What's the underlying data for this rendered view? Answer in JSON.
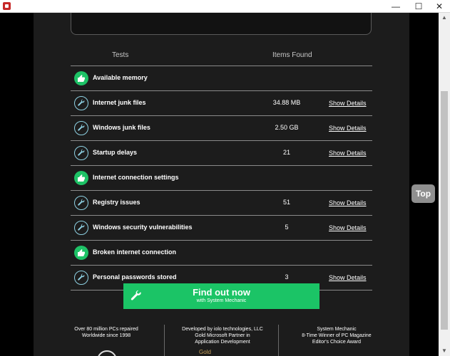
{
  "window": {
    "buttons": {
      "minimize": "—",
      "maximize": "☐",
      "close": "✕"
    }
  },
  "page": {
    "top_button": "Top",
    "table": {
      "headers": {
        "tests": "Tests",
        "items": "Items Found"
      },
      "rows": [
        {
          "icon": "thumbs-up-icon",
          "label": "Available memory",
          "value": "",
          "link": ""
        },
        {
          "icon": "wrench-icon",
          "label": "Internet junk files",
          "value": "34.88 MB",
          "link": "Show Details"
        },
        {
          "icon": "wrench-icon",
          "label": "Windows junk files",
          "value": "2.50 GB",
          "link": "Show Details"
        },
        {
          "icon": "wrench-icon",
          "label": "Startup delays",
          "value": "21",
          "link": "Show Details"
        },
        {
          "icon": "thumbs-up-icon",
          "label": "Internet connection settings",
          "value": "",
          "link": ""
        },
        {
          "icon": "wrench-icon",
          "label": "Registry issues",
          "value": "51",
          "link": "Show Details"
        },
        {
          "icon": "wrench-icon",
          "label": "Windows security vulnerabilities",
          "value": "5",
          "link": "Show Details"
        },
        {
          "icon": "thumbs-up-icon",
          "label": "Broken internet connection",
          "value": "",
          "link": ""
        },
        {
          "icon": "wrench-icon",
          "label": "Personal passwords stored",
          "value": "3",
          "link": "Show Details"
        }
      ]
    },
    "cta": {
      "title": "Find out now",
      "subtitle": "with System Mechanic"
    },
    "footer": {
      "col1": [
        "Over 80 million PCs repaired",
        "Worldwide since 1998"
      ],
      "col2": [
        "Developed by iolo technologies, LLC",
        "Gold Microsoft Partner in",
        "Application Development"
      ],
      "col3": [
        "System Mechanic",
        "8-Time Winner of PC Magazine",
        "Editor's Choice Award"
      ],
      "gold": "Gold"
    }
  },
  "colors": {
    "accent_green": "#1bc466",
    "wrench_blue": "#8ed1e3",
    "background": "#1c1c1c"
  }
}
